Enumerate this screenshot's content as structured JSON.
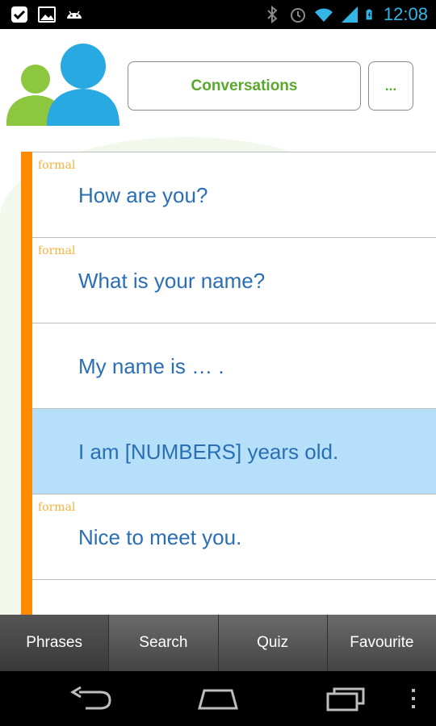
{
  "status_bar": {
    "time": "12:08",
    "left_icons": [
      "checkmark-notification-icon",
      "image-notification-icon",
      "android-notification-icon"
    ],
    "right_icons": [
      "bluetooth-icon",
      "alarm-icon",
      "wifi-icon",
      "signal-icon",
      "battery-icon"
    ],
    "color": "#33b5e5"
  },
  "header": {
    "logo_icon": "people-logo-icon",
    "conversations_label": "Conversations",
    "more_label": "..."
  },
  "phrases": [
    {
      "tag": "formal",
      "text": "How are you?"
    },
    {
      "tag": "formal",
      "text": "What is your name?"
    },
    {
      "tag": "",
      "text": "My name is … ."
    },
    {
      "tag": "",
      "text": "I am [NUMBERS] years old.",
      "selected": true
    },
    {
      "tag": "formal",
      "text": "Nice to meet you."
    },
    {
      "tag": "",
      "text": ""
    }
  ],
  "tabs": [
    {
      "label": "Phrases",
      "active": true
    },
    {
      "label": "Search"
    },
    {
      "label": "Quiz"
    },
    {
      "label": "Favourite"
    }
  ],
  "nav_bar": {
    "icons": [
      "back-icon",
      "home-icon",
      "recent-apps-icon",
      "overflow-menu-icon"
    ]
  },
  "colors": {
    "accent_orange": "#ff8c00",
    "selected_row": "#b6e0fa",
    "phrase_text": "#2a6eb5",
    "tag_text": "#f2b33d",
    "button_text": "#5aa72d",
    "logo_green": "#8dc63f",
    "logo_blue": "#29a9e1"
  }
}
